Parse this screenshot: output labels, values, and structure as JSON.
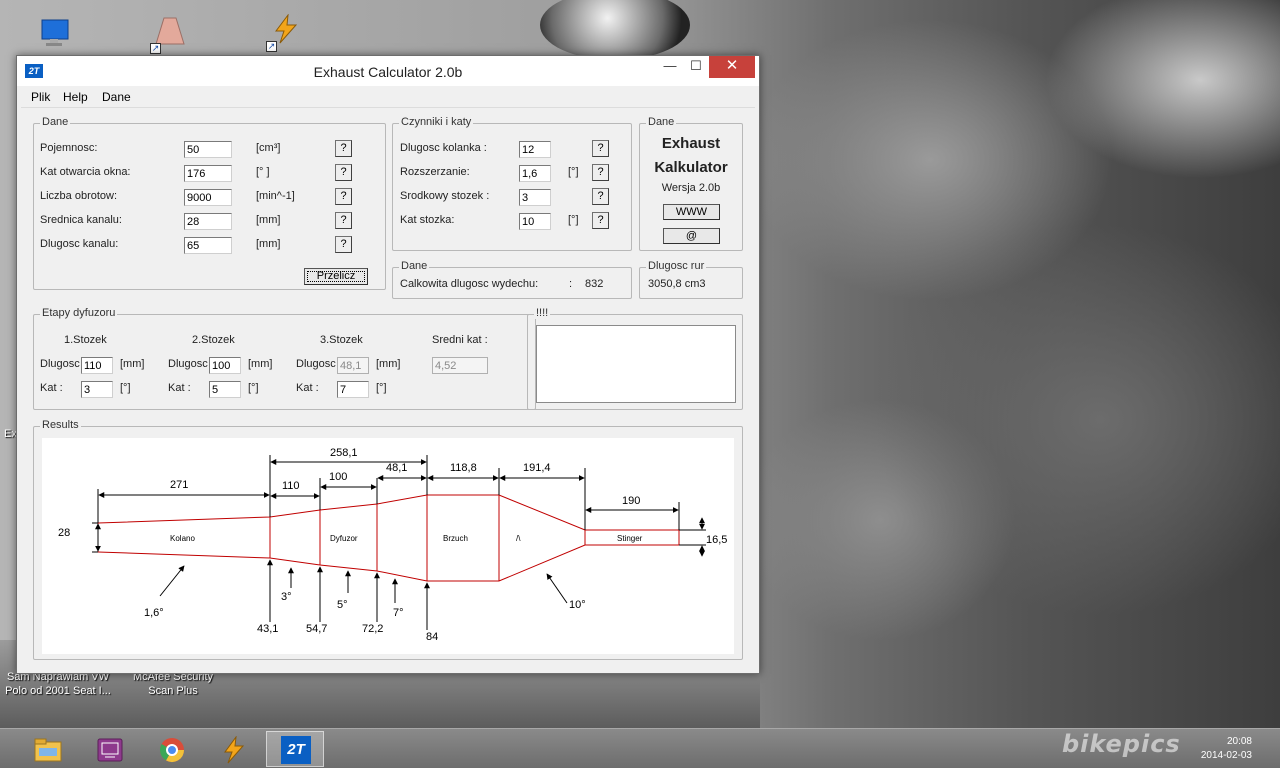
{
  "desktop": {
    "caption_left_line1": "Sam Naprawiam VW",
    "caption_left_line2": "Polo od 2001 Seat I...",
    "caption_mid_line1": "McAfee Security",
    "caption_mid_line2": "Scan Plus",
    "side_text": "Ex",
    "watermark": "bikepics"
  },
  "taskbar": {
    "app_label": "2T",
    "clock": "20:08",
    "date": "2014-02-03"
  },
  "window": {
    "title": "Exhaust Calculator 2.0b",
    "app_icon_label": "2T",
    "minimize": "—",
    "maximize": "☐",
    "close": "✕",
    "menu": [
      "Plik",
      "Help",
      "Dane"
    ]
  },
  "dane": {
    "title": "Dane",
    "rows": [
      {
        "label": "Pojemnosc:",
        "value": "50",
        "unit": "[cm³]"
      },
      {
        "label": "Kat otwarcia okna:",
        "value": "176",
        "unit": "[° ]"
      },
      {
        "label": "Liczba obrotow:",
        "value": "9000",
        "unit": "[min^-1]"
      },
      {
        "label": "Srednica kanalu:",
        "value": "28",
        "unit": "[mm]"
      },
      {
        "label": "Dlugosc kanalu:",
        "value": "65",
        "unit": "[mm]"
      }
    ],
    "help_label": "?",
    "calc_button": "Przelicz"
  },
  "czynniki": {
    "title": "Czynniki i katy",
    "rows": [
      {
        "label": "Dlugosc kolanka    :",
        "value": "12",
        "unit": ""
      },
      {
        "label": "Rozszerzanie:",
        "value": "1,6",
        "unit": "[°]"
      },
      {
        "label": "Srodkowy stozek  :",
        "value": "3",
        "unit": ""
      },
      {
        "label": "Kat stozka:",
        "value": "10",
        "unit": "[°]"
      }
    ],
    "help_label": "?"
  },
  "about": {
    "title": "Dane",
    "line1": "Exhaust",
    "line2": "Kalkulator",
    "version": "Wersja  2.0b",
    "www_button": "WWW",
    "mail_button": "@"
  },
  "total": {
    "title": "Dane",
    "label": "Calkowita dlugosc wydechu:",
    "sep": ":",
    "value": "832"
  },
  "volume": {
    "title": "Dlugosc rur",
    "value": "3050,8 cm3"
  },
  "etapy": {
    "title": "Etapy dyfuzoru",
    "stages": [
      {
        "header": "1.Stozek",
        "len_label": "Dlugosc",
        "len": "110",
        "len_unit": "[mm]",
        "ang_label": "Kat  :",
        "ang": "3",
        "ang_unit": "[°]"
      },
      {
        "header": "2.Stozek",
        "len_label": "Dlugosc",
        "len": "100",
        "len_unit": "[mm]",
        "ang_label": "Kat  :",
        "ang": "5",
        "ang_unit": "[°]"
      },
      {
        "header": "3.Stozek",
        "len_label": "Dlugosc",
        "len": "48,1",
        "len_unit": "[mm]",
        "ang_label": "Kat  :",
        "ang": "7",
        "ang_unit": "[°]"
      }
    ],
    "avg_label": "Sredni kat  :",
    "avg_value": "4,52"
  },
  "notes": {
    "title": "!!!!"
  },
  "results": {
    "title": "Results",
    "top_dims": {
      "kolano": "271",
      "s1": "110",
      "s2": "100",
      "s3": "48,1",
      "diffuser_total": "258,1",
      "brzuch": "118,8",
      "stozek": "191,4",
      "stinger": "190"
    },
    "side_dims": {
      "inlet": "28",
      "stinger": "16,5"
    },
    "segment_labels": {
      "kolano": "Kolano",
      "dyfuzor": "Dyfuzor",
      "brzuch": "Brzuch",
      "stozek": "/\\",
      "stinger": "Stinger"
    },
    "diameters": {
      "d1": "43,1",
      "d2": "54,7",
      "d3": "72,2",
      "d4": "84"
    },
    "angles": {
      "a_kolano": "1,6°",
      "a1": "3°",
      "a2": "5°",
      "a3": "7°",
      "a_stozek": "10°"
    }
  }
}
